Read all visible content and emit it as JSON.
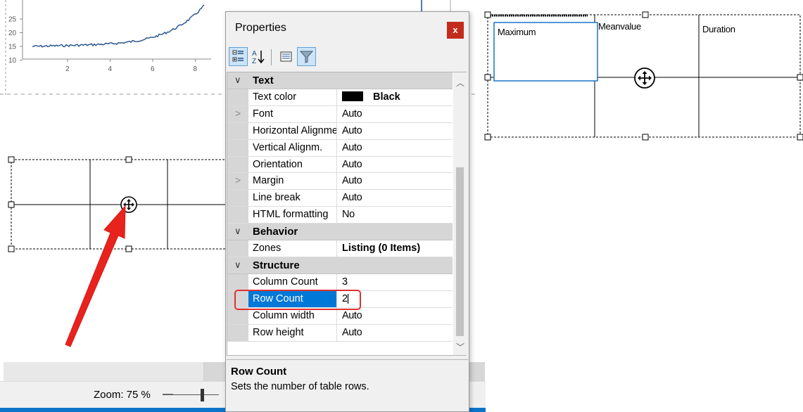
{
  "chart": {
    "y_ticks": [
      "25",
      "20",
      "15",
      "10"
    ],
    "x_ticks": [
      "2",
      "4",
      "6",
      "8"
    ],
    "line_color": "#1f4e8c"
  },
  "designer": {
    "zoom_label": "Zoom: 75 %",
    "zoom_level": 0.7,
    "zoom_minus": "—"
  },
  "properties": {
    "title": "Properties",
    "close_label": "x",
    "toolbar": [
      {
        "name": "categorized-view-icon",
        "active": true
      },
      {
        "name": "alphabetical-sort-icon",
        "active": false
      },
      {
        "name": "property-pages-icon",
        "active": false
      },
      {
        "name": "filter-icon",
        "active": true
      }
    ],
    "categories": [
      {
        "label": "Text",
        "rows": [
          {
            "name": "Text color",
            "value": "Black",
            "swatch": "#000000",
            "bold": true,
            "expandable": false
          },
          {
            "name": "Font",
            "value": "Auto",
            "expandable": true
          },
          {
            "name": "Horizontal Alignment",
            "value": "Auto",
            "expandable": false
          },
          {
            "name": "Vertical Alignm.",
            "value": "Auto",
            "expandable": false
          },
          {
            "name": "Orientation",
            "value": "Auto",
            "expandable": false
          },
          {
            "name": "Margin",
            "value": "Auto",
            "expandable": true
          },
          {
            "name": "Line break",
            "value": "Auto",
            "expandable": false
          },
          {
            "name": "HTML formatting",
            "value": "No",
            "expandable": false
          }
        ]
      },
      {
        "label": "Behavior",
        "rows": [
          {
            "name": "Zones",
            "value": "Listing (0 Items)",
            "bold": true,
            "expandable": false
          }
        ]
      },
      {
        "label": "Structure",
        "rows": [
          {
            "name": "Column Count",
            "value": "3",
            "expandable": false
          },
          {
            "name": "Row Count",
            "value": "2",
            "selected": true,
            "expandable": false
          },
          {
            "name": "Column width",
            "value": "Auto",
            "expandable": false
          },
          {
            "name": "Row height",
            "value": "Auto",
            "expandable": false
          }
        ]
      }
    ],
    "help_title": "Row Count",
    "help_desc": "Sets the number of table rows."
  },
  "preview": {
    "headers": [
      "Maximum",
      "Meanvalue",
      "Duration"
    ]
  },
  "colors": {
    "selection": "#0078d7",
    "highlight": "#e0312e",
    "arrow": "#e8231d",
    "close": "#c42b1c"
  }
}
